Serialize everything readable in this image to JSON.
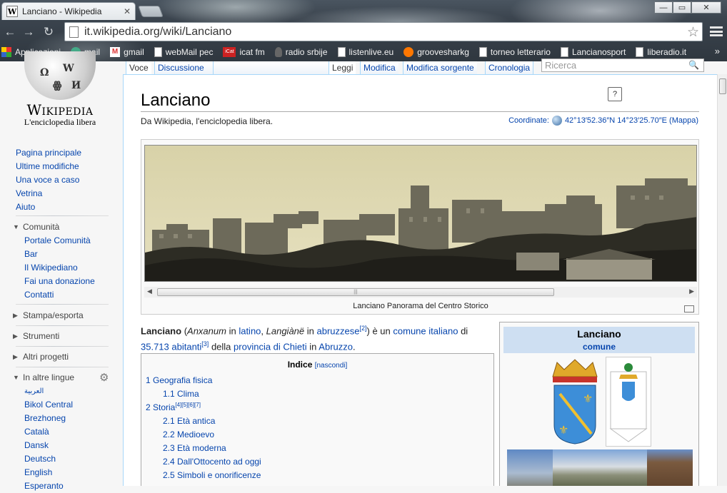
{
  "browser": {
    "tab_title": "Lanciano - Wikipedia",
    "tab_favicon": "W",
    "url": "it.wikipedia.org/wiki/Lanciano",
    "window_buttons": {
      "minimize": "—",
      "restore": "▭",
      "close": "✕"
    },
    "bookmarks": [
      {
        "label": "Applicazioni",
        "icon": "apps-icon"
      },
      {
        "label": "mail",
        "icon": "mail-icon"
      },
      {
        "label": "gmail",
        "icon": "gmail-icon"
      },
      {
        "label": "webMail pec",
        "icon": "page-icon"
      },
      {
        "label": "icat fm",
        "icon": "icat-icon"
      },
      {
        "label": "radio srbije",
        "icon": "microphone-icon"
      },
      {
        "label": "listenlive.eu",
        "icon": "page-icon"
      },
      {
        "label": "groovesharkg",
        "icon": "grooveshark-icon"
      },
      {
        "label": "torneo letterario",
        "icon": "page-icon"
      },
      {
        "label": "Lancianosport",
        "icon": "page-icon"
      },
      {
        "label": "liberadio.it",
        "icon": "page-icon"
      }
    ],
    "bookmarks_more": "»"
  },
  "logo": {
    "title": "Wikipedia",
    "subtitle": "L'enciclopedia libera"
  },
  "sidebar": {
    "nav": [
      "Pagina principale",
      "Ultime modifiche",
      "Una voce a caso",
      "Vetrina",
      "Aiuto"
    ],
    "comunita": {
      "label": "Comunità",
      "items": [
        "Portale Comunità",
        "Bar",
        "Il Wikipediano",
        "Fai una donazione",
        "Contatti"
      ]
    },
    "stampa": "Stampa/esporta",
    "strumenti": "Strumenti",
    "altri": "Altri progetti",
    "lingue": {
      "label": "In altre lingue",
      "items": [
        "العربية",
        "Bikol Central",
        "Brezhoneg",
        "Català",
        "Dansk",
        "Deutsch",
        "English",
        "Esperanto"
      ]
    }
  },
  "tabs": {
    "voce": "Voce",
    "discussione": "Discussione",
    "leggi": "Leggi",
    "modifica": "Modifica",
    "modifica_sorgente": "Modifica sorgente",
    "cronologia": "Cronologia",
    "search_placeholder": "Ricerca"
  },
  "article": {
    "title": "Lanciano",
    "tagline": "Da Wikipedia, l'enciclopedia libera.",
    "coords_label": "Coordinate:",
    "coords_value": "42°13′52.36″N 14°23′25.70″E (Mappa)",
    "pano_caption": "Lanciano Panorama del Centro Storico",
    "lead": {
      "name": "Lanciano",
      "latin_name": "Anxanum",
      "in1": "in",
      "latino": "latino",
      "dialect_name": "Langiànë",
      "in2": "in",
      "abruzzese": "abruzzese",
      "ref2": "[2]",
      "is_a": ") è un",
      "comune_italiano": "comune italiano",
      "di": "di",
      "abitanti": "35.713 abitanti",
      "ref3": "[3]",
      "della": "della",
      "provincia": "provincia di Chieti",
      "in3": "in",
      "abruzzo": "Abruzzo",
      "end": "."
    },
    "toc": {
      "title": "Indice",
      "hide": "[nascondi]",
      "items": [
        {
          "text": "1 Geografia fisica",
          "sup": ""
        },
        {
          "text": "1.1 Clima",
          "sup": ""
        },
        {
          "text": "2 Storia",
          "sup": "[4][5][6][7]"
        },
        {
          "text": "2.1 Età antica",
          "sup": ""
        },
        {
          "text": "2.2 Medioevo",
          "sup": ""
        },
        {
          "text": "2.3 Età moderna",
          "sup": ""
        },
        {
          "text": "2.4 Dall'Ottocento ad oggi",
          "sup": ""
        },
        {
          "text": "2.5 Simboli e onorificenze",
          "sup": ""
        }
      ]
    },
    "infobox": {
      "name": "Lanciano",
      "type": "comune"
    }
  }
}
